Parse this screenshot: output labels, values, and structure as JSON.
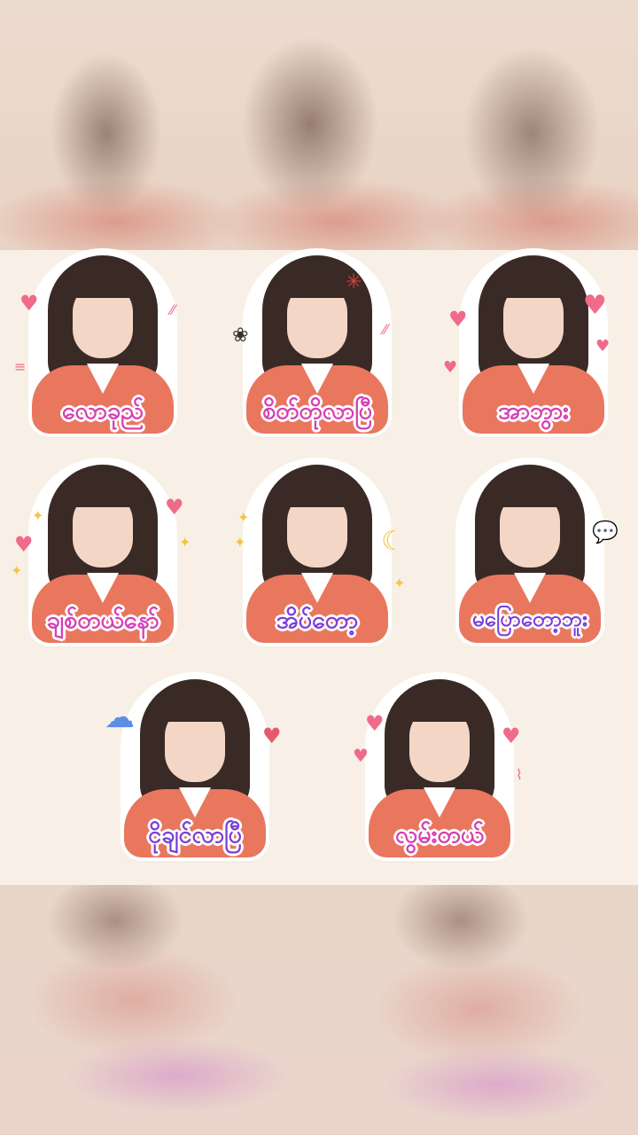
{
  "stickers": [
    {
      "caption": "လောခုည်",
      "decor": "heart-icon"
    },
    {
      "caption": "စိတ်တိုလာပြီ",
      "decor": "anger-icon"
    },
    {
      "caption": "အာဘွား",
      "decor": "heart-icon"
    },
    {
      "caption": "ချစ်တယ်နော်",
      "decor": "heart-icon"
    },
    {
      "caption": "အိပ်တော့",
      "decor": "moon-icon"
    },
    {
      "caption": "မပြောတော့ဘူး",
      "decor": "speech-bubble-icon"
    },
    {
      "caption": "ငိုချင်လာပြီ",
      "decor": "rain-cloud-icon"
    },
    {
      "caption": "လွမ်းတယ်",
      "decor": "heart-icon"
    }
  ],
  "colors": {
    "caption_pink": "#d43fb5",
    "caption_purple": "#7b3fd6",
    "jacket": "#e9775e",
    "sheet_background": "#f8f0e6"
  }
}
